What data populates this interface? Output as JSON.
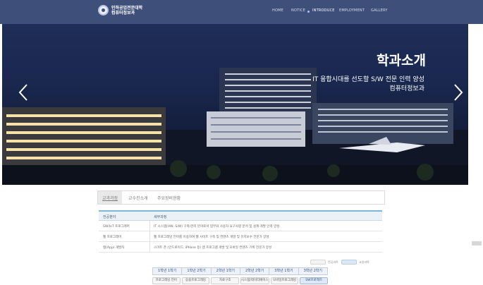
{
  "header": {
    "logo_line1": "인하공업전문대학",
    "logo_line2": "컴퓨터정보과",
    "nav": [
      "HOME",
      "NOTICE",
      "INTRODUCE",
      "EMPLOYMENT",
      "GALLERY"
    ],
    "active_nav": "INTRODUCE",
    "background_color": "#3e4f7a"
  },
  "hero": {
    "title": "학과소개",
    "subtitle_line1": "IT 융합시대를 선도할 S/W 전문 인력 양성",
    "subtitle_line2": "컴퓨터정보과",
    "prev_icon": "chevron-left-icon",
    "next_icon": "chevron-right-icon"
  },
  "tabs": {
    "items": [
      "교과과정",
      "교수진소개",
      "주요장비현황"
    ],
    "active": "교과과정"
  },
  "curriculum_table": {
    "headers": [
      "전공분야",
      "세부과정"
    ],
    "rows": [
      [
        "SW/IoT 프로그래머",
        "IT 시스템(HW, S/W) 구축/관리 분야로서 업무와 사용자 요구사항 분석 및 설계·개발 인력 양성"
      ],
      [
        "웹 프로그래머",
        "웹 프로그래밍 언어를 이용하여 웹 사이트 구축 및 컨텐츠 개발 및 유지보수 전문가 양성"
      ],
      [
        "앱(App) 개발자",
        "스마트 폰 (안드로이드, iPhone 등) 앱 프로그램 개발 및 모바일 컨텐츠 기획 전문가 양성"
      ]
    ]
  },
  "legend": {
    "items": [
      "전공과목",
      "교양과목"
    ]
  },
  "semesters": [
    "1학년 1학기",
    "1학년 2학기",
    "2학년 1학기",
    "2학년 2학기",
    "3학년 1학기",
    "3학년 2학기"
  ],
  "categories": {
    "items": [
      "프로그래밍 언어",
      "응용프로그래밍",
      "자료구조",
      "시스템/데이터베이스",
      "모바일프로그래밍",
      "SW프로젝트"
    ],
    "selected": "SW프로젝트"
  }
}
